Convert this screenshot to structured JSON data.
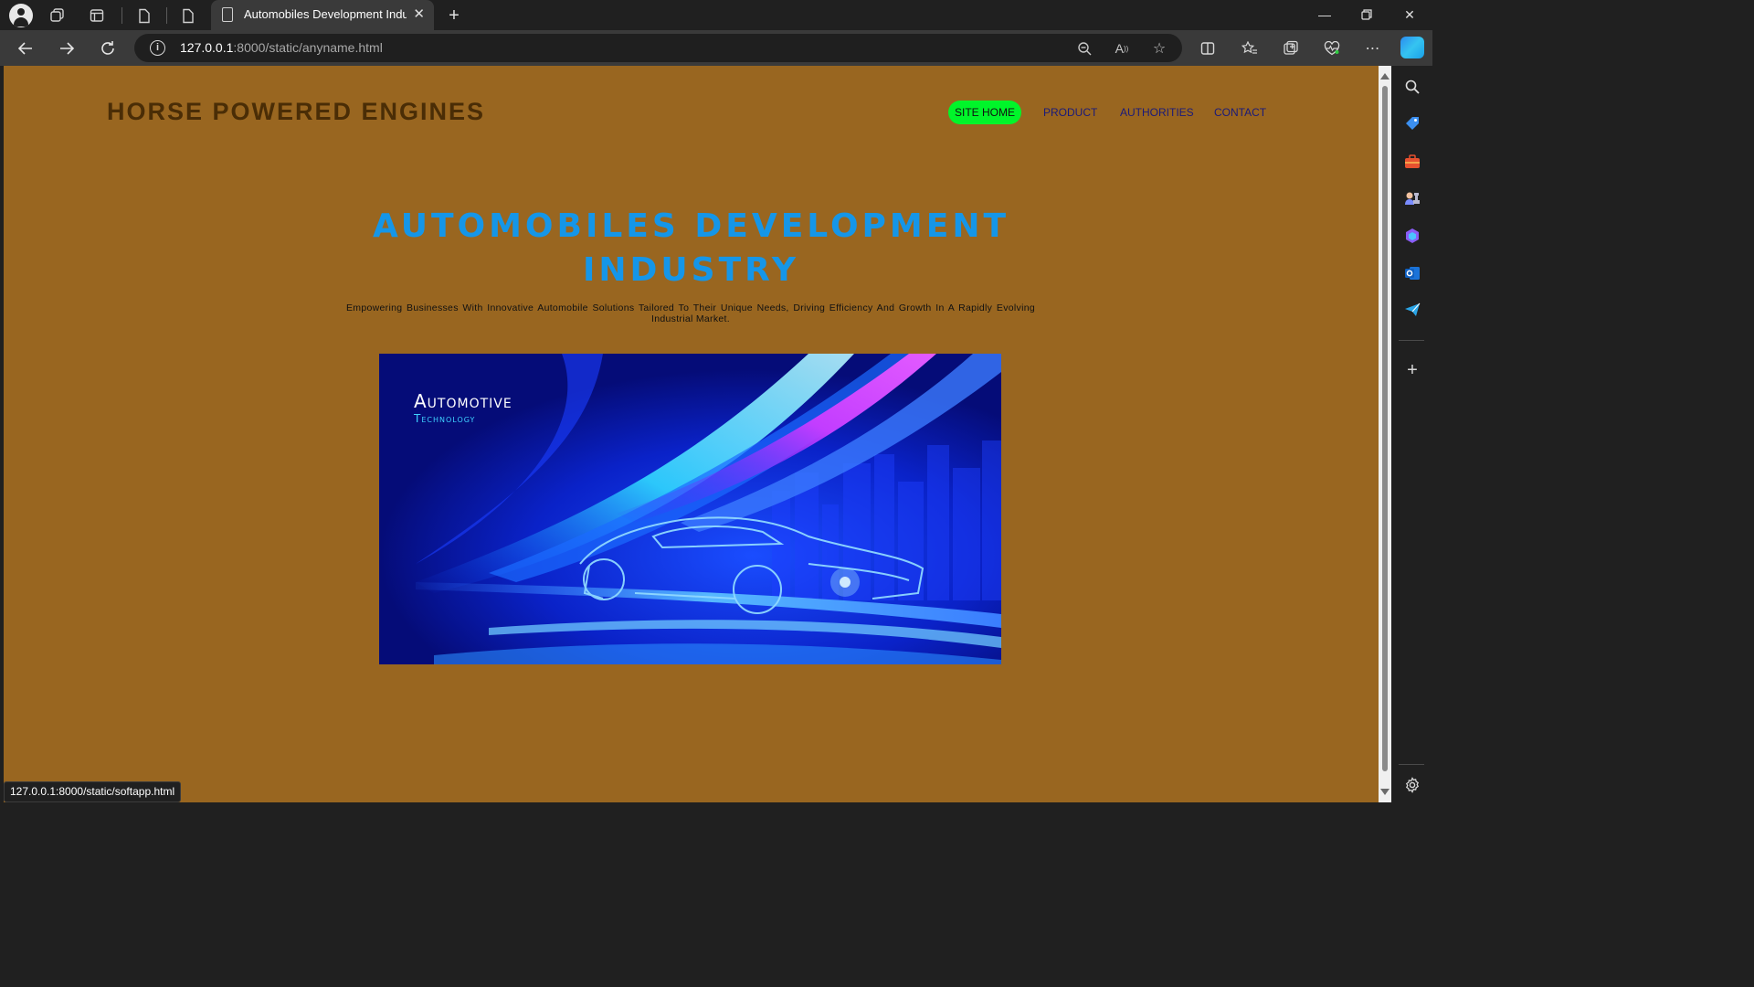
{
  "browser": {
    "tab_title": "Automobiles Development Indut",
    "url_host": "127.0.0.1",
    "url_path": ":8000/static/anyname.html",
    "status_url": "127.0.0.1:8000/static/softapp.html"
  },
  "site": {
    "brand": "HORSE POWERED ENGINES",
    "nav": [
      {
        "label": "SITE HOME",
        "active": true
      },
      {
        "label": "PRODUCT"
      },
      {
        "label": "AUTHORITIES"
      },
      {
        "label": "CONTACT"
      }
    ],
    "colors": {
      "page_background": "#996620",
      "brand": "#4a2d06",
      "hero_title": "#1596e8",
      "nav_active_pill": "#00f52a",
      "nav_link": "#1a1a7a"
    }
  },
  "hero": {
    "title_line1": "AUTOMOBILES DEVELOPMENT",
    "title_line2": "INDUSTRY",
    "subtitle": "Empowering Businesses With Innovative Automobile Solutions Tailored To Their Unique Needs, Driving Efficiency And Growth In A Rapidly Evolving Industrial Market.",
    "image": {
      "heading": "Automotive",
      "subheading": "Technology"
    }
  }
}
